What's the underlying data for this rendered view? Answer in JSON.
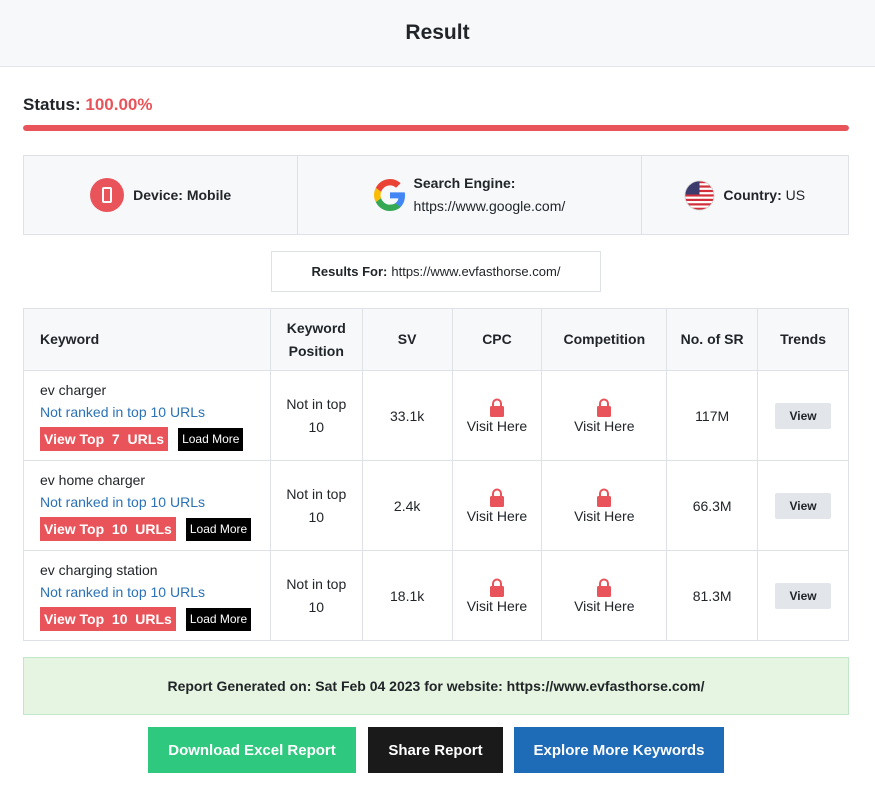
{
  "header": {
    "title": "Result"
  },
  "status": {
    "label": "Status:",
    "value": "100.00%",
    "progress_fraction": 1.0
  },
  "info": {
    "device_label": "Device:",
    "device_value": "Mobile",
    "engine_label": "Search Engine:",
    "engine_value": "https://www.google.com/",
    "country_label": "Country:",
    "country_value": "US"
  },
  "results_for": {
    "label": "Results For:",
    "value": "https://www.evfasthorse.com/"
  },
  "table": {
    "headers": {
      "keyword": "Keyword",
      "position_line1": "Keyword",
      "position_line2": "Position",
      "sv": "SV",
      "cpc": "CPC",
      "competition": "Competition",
      "no_of_sr": "No. of SR",
      "trends": "Trends"
    },
    "rows": [
      {
        "keyword": "ev charger",
        "rank_text": "Not ranked in top 10 URLs",
        "view_top": "View Top  7  URLs",
        "load_more": "Load More",
        "position_line1": "Not in top",
        "position_line2": "10",
        "sv": "33.1k",
        "cpc": "Visit Here",
        "competition": "Visit Here",
        "no_of_sr": "117M",
        "trends": "View"
      },
      {
        "keyword": "ev home charger",
        "rank_text": "Not ranked in top 10 URLs",
        "view_top": "View Top  10  URLs",
        "load_more": "Load More",
        "position_line1": "Not in top",
        "position_line2": "10",
        "sv": "2.4k",
        "cpc": "Visit Here",
        "competition": "Visit Here",
        "no_of_sr": "66.3M",
        "trends": "View"
      },
      {
        "keyword": "ev charging station",
        "rank_text": "Not ranked in top 10 URLs",
        "view_top": "View Top  10  URLs",
        "load_more": "Load More",
        "position_line1": "Not in top",
        "position_line2": "10",
        "sv": "18.1k",
        "cpc": "Visit Here",
        "competition": "Visit Here",
        "no_of_sr": "81.3M",
        "trends": "View"
      }
    ]
  },
  "report": {
    "text": "Report Generated on: Sat Feb 04 2023 for website: https://www.evfasthorse.com/"
  },
  "buttons": {
    "download": "Download Excel Report",
    "share": "Share Report",
    "explore": "Explore More Keywords"
  },
  "colors": {
    "accent_red": "#e9545b",
    "link_blue": "#2a72b5",
    "green_button": "#2ec97e",
    "blue_button": "#1e6bb8"
  },
  "icons": {
    "device": "mobile-phone-icon",
    "engine": "google-logo-icon",
    "country": "us-flag-icon",
    "locked": "lock-icon"
  }
}
